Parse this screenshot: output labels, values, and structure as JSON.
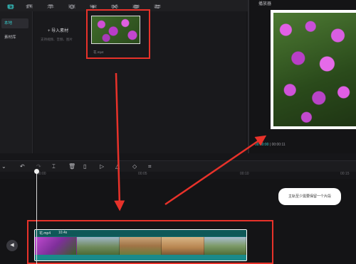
{
  "top_toolbar": {
    "tabs": [
      {
        "label": "媒体",
        "icon": "media-icon",
        "active": true
      },
      {
        "label": "音频",
        "icon": "audio-icon"
      },
      {
        "label": "文本",
        "icon": "text-icon"
      },
      {
        "label": "贴纸",
        "icon": "sticker-icon"
      },
      {
        "label": "特效",
        "icon": "effects-icon"
      },
      {
        "label": "转场",
        "icon": "transition-icon"
      },
      {
        "label": "滤镜",
        "icon": "filter-icon"
      },
      {
        "label": "调节",
        "icon": "adjust-icon"
      }
    ]
  },
  "left_nav": {
    "items": [
      {
        "label": "本地",
        "active": true
      },
      {
        "label": "素材库"
      }
    ]
  },
  "media": {
    "import_label": "导入素材",
    "import_hint": "支持视频、音频、图片",
    "file_name": "花.mp4"
  },
  "player": {
    "title": "播放器",
    "time_current": "00:00:00",
    "time_total": "00:00:11"
  },
  "timeline": {
    "ruler_labels": [
      "00:00",
      "00:05",
      "00:10",
      "00:15"
    ],
    "tooltip": "主轨至少需要保留一个片段",
    "clip_name": "花.mp4",
    "clip_duration": "10.4s"
  },
  "colors": {
    "accent": "#37d0cf",
    "annotation_red": "#e8322a",
    "clip_track": "#136b6b"
  }
}
